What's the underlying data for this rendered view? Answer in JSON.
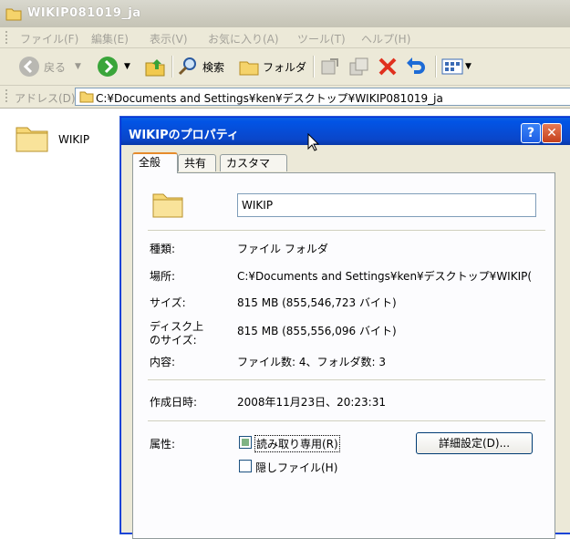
{
  "window": {
    "title": "WIKIP081019_ja",
    "menu": [
      "ファイル(F)",
      "編集(E)",
      "表示(V)",
      "お気に入り(A)",
      "ツール(T)",
      "ヘルプ(H)"
    ],
    "toolbar": {
      "back_label": "戻る",
      "search_label": "検索",
      "folders_label": "フォルダ"
    },
    "address": {
      "label": "アドレス(D)",
      "path": "C:¥Documents and Settings¥ken¥デスクトップ¥WIKIP081019_ja"
    },
    "items": [
      {
        "label": "WIKIP"
      }
    ]
  },
  "dialog": {
    "title": "WIKIPのプロパティ",
    "help_glyph": "?",
    "close_glyph": "✕",
    "tabs": [
      "全般",
      "共有",
      "カスタマイズ"
    ],
    "name_value": "WIKIP",
    "type_label": "種類:",
    "type_value": "ファイル フォルダ",
    "location_label": "場所:",
    "location_value": "C:¥Documents and Settings¥ken¥デスクトップ¥WIKIP(",
    "size_label": "サイズ:",
    "size_value": "815 MB (855,546,723 バイト)",
    "disk_size_label_1": "ディスク上",
    "disk_size_label_2": "のサイズ:",
    "disk_size_value": "815 MB (855,556,096 バイト)",
    "contents_label": "内容:",
    "contents_value": "ファイル数: 4、フォルダ数: 3",
    "created_label": "作成日時:",
    "created_value": "2008年11月23日、20:23:31",
    "attributes_label": "属性:",
    "readonly_label": "読み取り専用(R)",
    "hidden_label": "隠しファイル(H)",
    "advanced_button": "詳細設定(D)..."
  },
  "colors": {
    "title_active": "#0a46c9",
    "xp_face": "#ece9d8",
    "tab_highlight": "#e68b2c"
  }
}
